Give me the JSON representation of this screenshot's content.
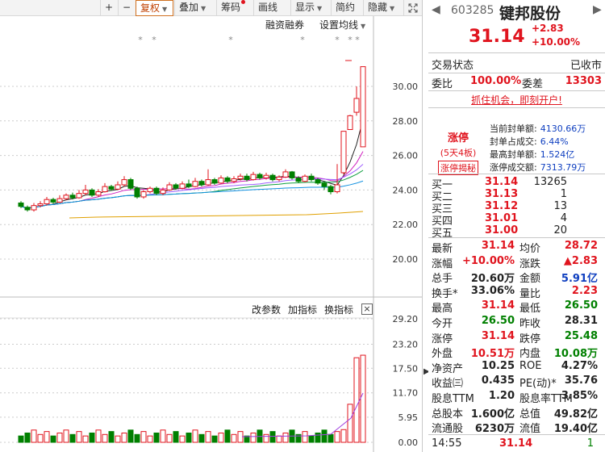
{
  "toolbar": {
    "plus": "+",
    "minus": "−",
    "items": [
      "复权",
      "叠加",
      "筹码",
      "画线",
      "显示",
      "简约",
      "隐藏"
    ],
    "fullscreen_icon": "fullscreen-icon",
    "badge_color": "#e0141e"
  },
  "main_chart": {
    "margin_label": "融资融券",
    "ma_settings_label": "设置均线",
    "y_ticks": [
      "30.00",
      "28.00",
      "26.00",
      "24.00",
      "22.00",
      "20.00"
    ],
    "candles": [
      {
        "o": 23.25,
        "c": 23.05,
        "h": 23.35,
        "l": 22.95
      },
      {
        "o": 23.0,
        "c": 22.85,
        "h": 23.1,
        "l": 22.75
      },
      {
        "o": 22.85,
        "c": 23.1,
        "h": 23.25,
        "l": 22.75
      },
      {
        "o": 23.1,
        "c": 23.2,
        "h": 23.35,
        "l": 23.0
      },
      {
        "o": 23.2,
        "c": 23.45,
        "h": 23.6,
        "l": 23.1
      },
      {
        "o": 23.45,
        "c": 23.3,
        "h": 23.55,
        "l": 23.2
      },
      {
        "o": 23.3,
        "c": 23.5,
        "h": 23.7,
        "l": 23.25
      },
      {
        "o": 23.5,
        "c": 23.7,
        "h": 23.8,
        "l": 23.4
      },
      {
        "o": 23.7,
        "c": 23.55,
        "h": 23.85,
        "l": 23.45
      },
      {
        "o": 23.55,
        "c": 23.8,
        "h": 24.0,
        "l": 23.5
      },
      {
        "o": 23.8,
        "c": 24.0,
        "h": 24.3,
        "l": 23.7
      },
      {
        "o": 24.0,
        "c": 23.7,
        "h": 24.1,
        "l": 23.6
      },
      {
        "o": 23.7,
        "c": 23.9,
        "h": 24.05,
        "l": 23.6
      },
      {
        "o": 23.9,
        "c": 24.2,
        "h": 24.4,
        "l": 23.85
      },
      {
        "o": 24.2,
        "c": 24.05,
        "h": 24.3,
        "l": 23.95
      },
      {
        "o": 24.05,
        "c": 24.3,
        "h": 24.5,
        "l": 24.0
      },
      {
        "o": 24.3,
        "c": 24.6,
        "h": 24.8,
        "l": 24.2
      },
      {
        "o": 24.6,
        "c": 24.1,
        "h": 24.7,
        "l": 24.0
      },
      {
        "o": 24.1,
        "c": 23.6,
        "h": 24.2,
        "l": 23.5
      },
      {
        "o": 23.6,
        "c": 23.9,
        "h": 24.0,
        "l": 23.5
      },
      {
        "o": 23.9,
        "c": 24.1,
        "h": 24.2,
        "l": 23.8
      },
      {
        "o": 24.1,
        "c": 23.8,
        "h": 24.2,
        "l": 23.7
      },
      {
        "o": 23.8,
        "c": 24.0,
        "h": 24.15,
        "l": 23.7
      },
      {
        "o": 24.0,
        "c": 24.3,
        "h": 24.45,
        "l": 23.95
      },
      {
        "o": 24.3,
        "c": 24.1,
        "h": 24.4,
        "l": 24.0
      },
      {
        "o": 24.1,
        "c": 24.35,
        "h": 24.5,
        "l": 24.05
      },
      {
        "o": 24.35,
        "c": 24.2,
        "h": 24.6,
        "l": 24.1
      },
      {
        "o": 24.2,
        "c": 24.5,
        "h": 24.7,
        "l": 24.15
      },
      {
        "o": 24.5,
        "c": 24.3,
        "h": 24.6,
        "l": 24.2
      },
      {
        "o": 24.3,
        "c": 24.6,
        "h": 25.2,
        "l": 24.25
      },
      {
        "o": 24.6,
        "c": 24.4,
        "h": 24.7,
        "l": 24.3
      },
      {
        "o": 24.4,
        "c": 24.7,
        "h": 24.85,
        "l": 24.35
      },
      {
        "o": 24.7,
        "c": 24.5,
        "h": 24.8,
        "l": 24.4
      },
      {
        "o": 24.5,
        "c": 24.65,
        "h": 24.8,
        "l": 24.4
      },
      {
        "o": 24.65,
        "c": 24.8,
        "h": 24.95,
        "l": 24.55
      },
      {
        "o": 24.8,
        "c": 24.6,
        "h": 24.95,
        "l": 24.5
      },
      {
        "o": 24.6,
        "c": 24.9,
        "h": 25.05,
        "l": 24.55
      },
      {
        "o": 24.9,
        "c": 24.7,
        "h": 25.0,
        "l": 24.6
      },
      {
        "o": 24.7,
        "c": 24.85,
        "h": 25.0,
        "l": 24.6
      },
      {
        "o": 24.85,
        "c": 24.6,
        "h": 24.95,
        "l": 24.5
      },
      {
        "o": 24.6,
        "c": 24.75,
        "h": 24.85,
        "l": 24.5
      },
      {
        "o": 24.75,
        "c": 25.05,
        "h": 25.2,
        "l": 24.7
      },
      {
        "o": 25.05,
        "c": 24.7,
        "h": 25.1,
        "l": 24.6
      },
      {
        "o": 24.7,
        "c": 24.5,
        "h": 24.8,
        "l": 24.4
      },
      {
        "o": 24.5,
        "c": 24.8,
        "h": 24.9,
        "l": 24.45
      },
      {
        "o": 24.8,
        "c": 24.6,
        "h": 24.95,
        "l": 24.5
      },
      {
        "o": 24.6,
        "c": 24.4,
        "h": 24.7,
        "l": 24.3
      },
      {
        "o": 24.4,
        "c": 24.2,
        "h": 24.5,
        "l": 24.0
      },
      {
        "o": 24.2,
        "c": 23.9,
        "h": 24.3,
        "l": 23.75
      },
      {
        "o": 23.9,
        "c": 24.3,
        "h": 25.5,
        "l": 23.8
      },
      {
        "o": 25.0,
        "c": 27.4,
        "h": 27.4,
        "l": 24.9
      },
      {
        "o": 27.5,
        "c": 28.3,
        "h": 28.35,
        "l": 27.5
      },
      {
        "o": 28.5,
        "c": 29.3,
        "h": 30.0,
        "l": 28.3
      },
      {
        "o": 26.5,
        "c": 31.14,
        "h": 31.14,
        "l": 26.5
      }
    ],
    "markers": [
      "*",
      "*",
      "*",
      "*",
      "*",
      "*",
      "*"
    ]
  },
  "indicator": {
    "labels": [
      "改参数",
      "加指标",
      "换指标"
    ],
    "close": "×",
    "y_ticks": [
      "29.20",
      "23.20",
      "17.50",
      "11.70",
      "5.95",
      "0.00"
    ]
  },
  "quote": {
    "code": "603285",
    "name": "键邦股份",
    "price": "31.14",
    "change": "+2.83",
    "change_pct": "+10.00%",
    "status_label": "交易状态",
    "status_value": "已收市",
    "wb_label": "委比",
    "wb_value": "100.00%",
    "wc_label": "委差",
    "wc_value": "13303",
    "promo": "抓住机会，即刻开户!",
    "limit_title": "涨停",
    "limit_sub": "(5天4板)",
    "limit_btn": "涨停揭秘",
    "limit_rows": [
      {
        "label": "当前封单额:",
        "value": "4130.66万"
      },
      {
        "label": "封单占成交:",
        "value": "6.44%"
      },
      {
        "label": "最高封单额:",
        "value": "1.524亿"
      },
      {
        "label": "涨停成交额:",
        "value": "7313.79万"
      }
    ],
    "bids": [
      {
        "label": "买一",
        "price": "31.14",
        "vol": "13265"
      },
      {
        "label": "买二",
        "price": "31.13",
        "vol": "1"
      },
      {
        "label": "买三",
        "price": "31.12",
        "vol": "13"
      },
      {
        "label": "买四",
        "price": "31.01",
        "vol": "4"
      },
      {
        "label": "买五",
        "price": "31.00",
        "vol": "20"
      }
    ],
    "stats": [
      {
        "l": "最新",
        "lv": "31.14",
        "lc": "red",
        "r": "均价",
        "rv": "28.72",
        "rc": "red"
      },
      {
        "l": "涨幅",
        "lv": "+10.00%",
        "lc": "red",
        "r": "涨跌",
        "rv": "▲2.83",
        "rc": "red"
      },
      {
        "l": "总手",
        "lv": "20.60万",
        "lc": "dark",
        "r": "金额",
        "rv": "5.91亿",
        "rc": "blue"
      },
      {
        "l": "换手*",
        "lv": "33.06%",
        "lc": "dark",
        "r": "量比",
        "rv": "2.23",
        "rc": "red"
      },
      {
        "l": "最高",
        "lv": "31.14",
        "lc": "red",
        "r": "最低",
        "rv": "26.50",
        "rc": "green"
      },
      {
        "l": "今开",
        "lv": "26.50",
        "lc": "green",
        "r": "昨收",
        "rv": "28.31",
        "rc": "dark"
      },
      {
        "l": "涨停",
        "lv": "31.14",
        "lc": "red",
        "r": "跌停",
        "rv": "25.48",
        "rc": "green"
      },
      {
        "l": "外盘",
        "lv": "10.51万",
        "lc": "red",
        "r": "内盘",
        "rv": "10.08万",
        "rc": "green"
      },
      {
        "l": "净资产",
        "lv": "10.25",
        "lc": "dark",
        "r": "ROE",
        "rv": "4.27%",
        "rc": "dark"
      },
      {
        "l": "收益㈢",
        "lv": "0.435",
        "lc": "dark",
        "r": "PE(动)*",
        "rv": "35.76",
        "rc": "dark"
      },
      {
        "l": "股息TTM",
        "lv": "1.20",
        "lc": "dark",
        "r": "股息率TTM",
        "rv": "3.85%",
        "rc": "dark"
      },
      {
        "l": "总股本",
        "lv": "1.600亿",
        "lc": "dark",
        "r": "总值",
        "rv": "49.82亿",
        "rc": "dark"
      },
      {
        "l": "流通股",
        "lv": "6230万",
        "lc": "dark",
        "r": "流值",
        "rv": "19.40亿",
        "rc": "dark"
      }
    ],
    "footer": {
      "time": "14:55",
      "price": "31.14",
      "vol": "1"
    }
  }
}
